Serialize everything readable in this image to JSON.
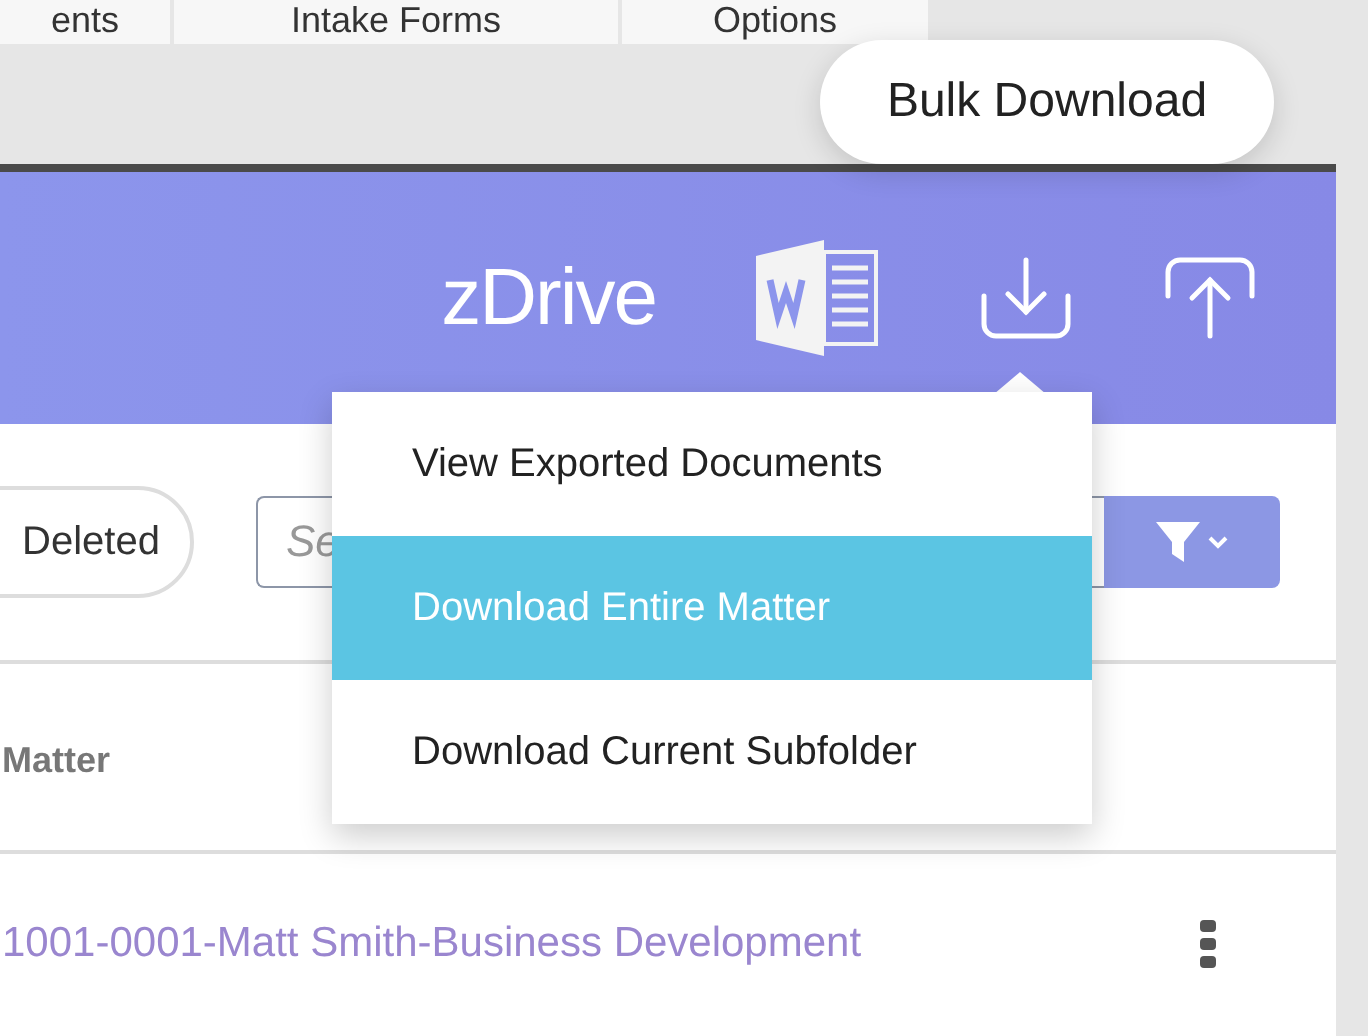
{
  "tabs": [
    {
      "label": "ents",
      "selected": false
    },
    {
      "label": "Intake Forms",
      "selected": false
    },
    {
      "label": "Options",
      "selected": false
    }
  ],
  "tooltip": {
    "text": "Bulk Download"
  },
  "header": {
    "logo": "zDrive"
  },
  "download_menu": {
    "items": [
      {
        "label": "View Exported Documents",
        "selected": false
      },
      {
        "label": "Download Entire Matter",
        "selected": true
      },
      {
        "label": "Download Current Subfolder",
        "selected": false
      }
    ]
  },
  "toolbar": {
    "deleted_button": "Deleted",
    "search": {
      "placeholder": "Se"
    }
  },
  "table": {
    "columns": [
      "Matter"
    ],
    "rows": [
      {
        "matter": "1001-0001-Matt Smith-Business Development"
      }
    ]
  }
}
